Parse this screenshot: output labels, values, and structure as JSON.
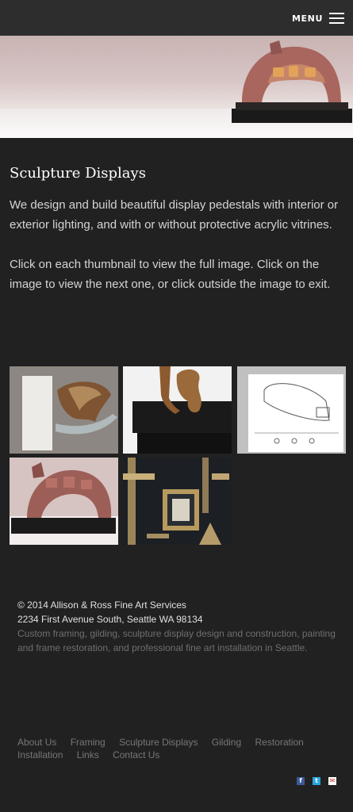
{
  "header": {
    "menu_label": "MENU"
  },
  "hero": {
    "icon": "sculpture-on-pedestal-image"
  },
  "content": {
    "title": "Sculpture Displays",
    "description": "We design and build beautiful display pedestals with interior or exterior lighting, and with or without protective acrylic vitrines.",
    "instructions": "Click on each thumbnail to view the full image. Click on the image to view the next one, or click outside the image to exit."
  },
  "gallery": {
    "thumbnails": [
      {
        "icon": "bronze-sculpture-on-acrylic-base-image"
      },
      {
        "icon": "bronze-figure-on-black-pedestal-image"
      },
      {
        "icon": "pedestal-design-drawing-image"
      },
      {
        "icon": "carved-sculpture-on-pedestal-image"
      },
      {
        "icon": "gilded-frame-samples-image"
      }
    ]
  },
  "footer": {
    "copyright": "© 2014 Allison & Ross Fine Art Services",
    "address": "2234 First Avenue South, Seattle WA 98134",
    "about": "Custom framing, gilding, sculpture display design and construction, painting and frame restoration, and professional fine art installation in Seattle.",
    "nav": [
      "About Us",
      "Framing",
      "Sculpture Displays",
      "Gilding",
      "Restoration",
      "Installation",
      "Links",
      "Contact Us"
    ],
    "social": {
      "facebook": "f",
      "twitter": "t",
      "email": "✉"
    }
  },
  "colors": {
    "background": "#222121",
    "topbar": "#2e2d2d",
    "facebook": "#3b5a99",
    "twitter": "#29a6df"
  }
}
